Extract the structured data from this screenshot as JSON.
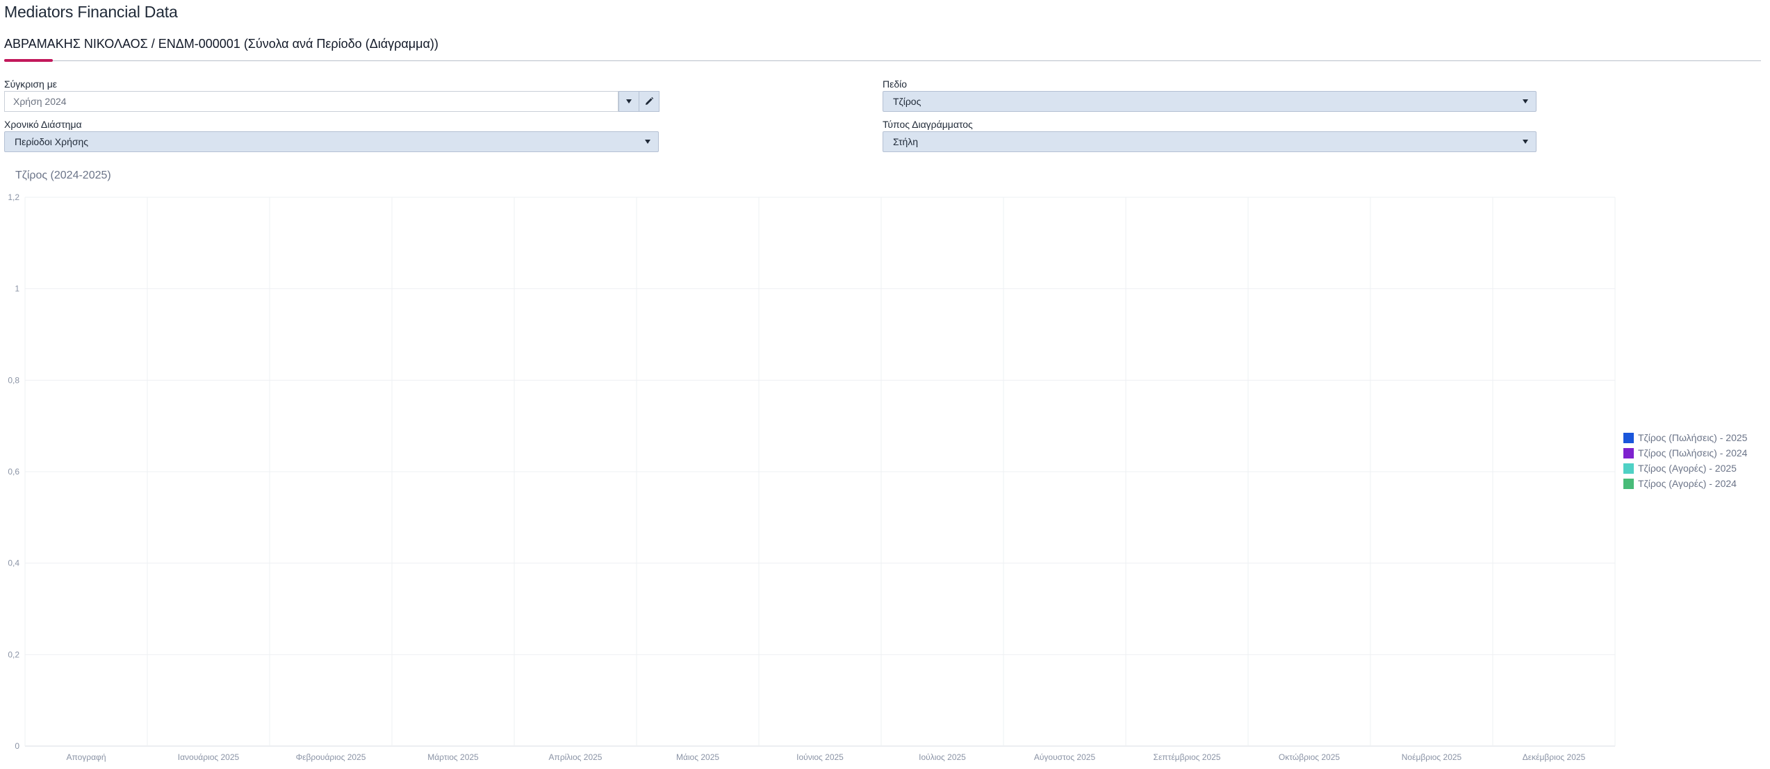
{
  "app": {
    "title": "Mediators Financial Data"
  },
  "tab": {
    "title": "ΑΒΡΑΜΑΚΗΣ ΝΙΚΟΛΑΟΣ / ΕΝΔΜ-000001 (Σύνολα ανά Περίοδο (Διάγραμμα))"
  },
  "filters": {
    "compare": {
      "label": "Σύγκριση με",
      "value": "Χρήση 2024"
    },
    "field": {
      "label": "Πεδίο",
      "value": "Τζίρος"
    },
    "period": {
      "label": "Χρονικό Διάστημα",
      "value": "Περίοδοι Χρήσης"
    },
    "chart_type": {
      "label": "Τύπος Διαγράμματος",
      "value": "Στήλη"
    }
  },
  "icons": {
    "compare_dropdown": "caret-down-icon",
    "compare_edit": "pencil-icon"
  },
  "chart_data": {
    "type": "bar",
    "title": "Τζίρος (2024-2025)",
    "categories": [
      "Απογραφή",
      "Ιανουάριος 2025",
      "Φεβρουάριος 2025",
      "Μάρτιος 2025",
      "Απρίλιος 2025",
      "Μάιος 2025",
      "Ιούνιος 2025",
      "Ιούλιος 2025",
      "Αύγουστος 2025",
      "Σεπτέμβριος 2025",
      "Οκτώβριος 2025",
      "Νοέμβριος 2025",
      "Δεκέμβριος 2025"
    ],
    "yticks": [
      "0",
      "0,2",
      "0,4",
      "0,6",
      "0,8",
      "1",
      "1,2"
    ],
    "ylim": [
      0,
      1.2
    ],
    "grid": true,
    "legend_position": "right",
    "series": [
      {
        "name": "Τζίρος (Πωλήσεις) - 2025",
        "color": "#1a56db",
        "values": []
      },
      {
        "name": "Τζίρος (Πωλήσεις) - 2024",
        "color": "#7e22ce",
        "values": []
      },
      {
        "name": "Τζίρος (Αγορές) - 2025",
        "color": "#4fd1c5",
        "values": []
      },
      {
        "name": "Τζίρος (Αγορές) - 2024",
        "color": "#48bb78",
        "values": []
      }
    ]
  }
}
